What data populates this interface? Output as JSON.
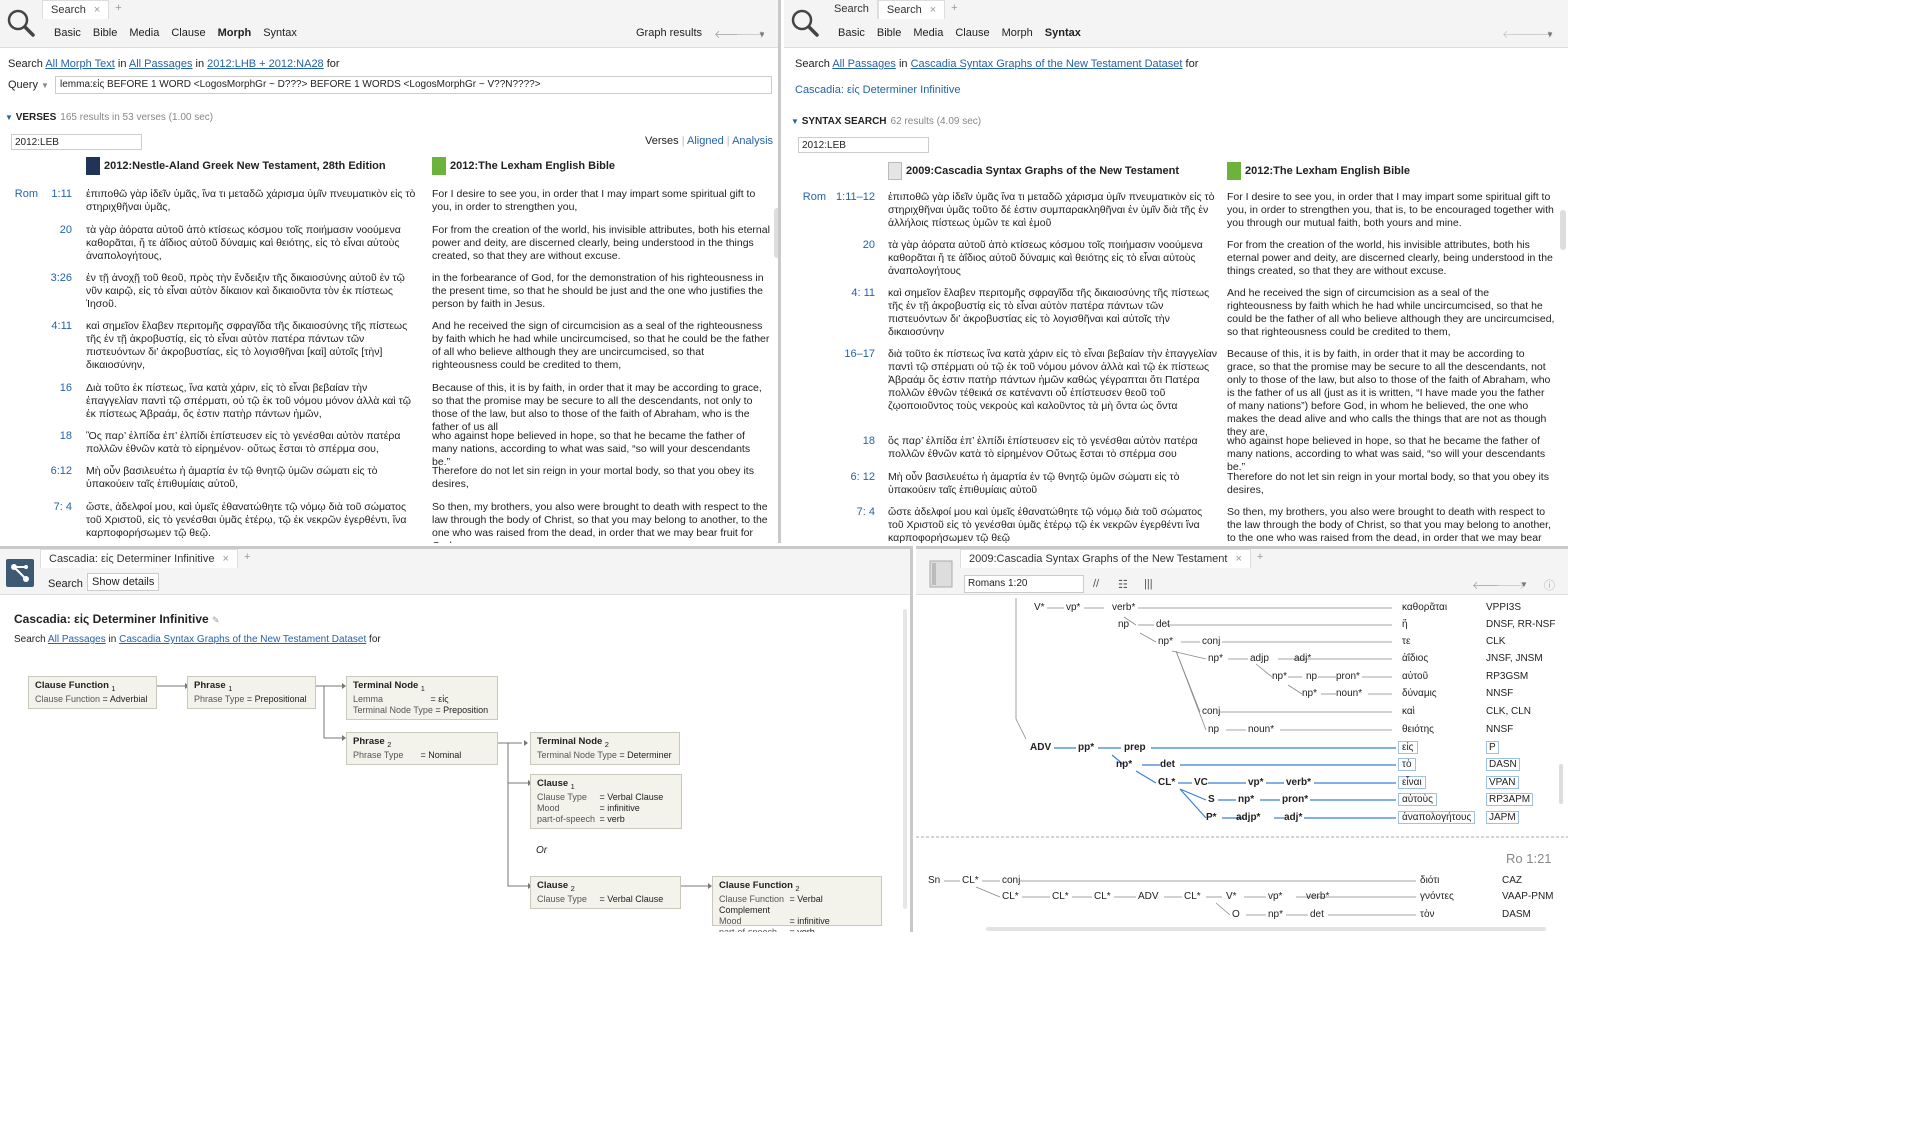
{
  "p1": {
    "tabs": [
      "Search"
    ],
    "subnav": [
      "Basic",
      "Bible",
      "Media",
      "Clause",
      "Morph",
      "Syntax"
    ],
    "graph_results": "Graph results",
    "search_line": {
      "pre": "Search",
      "what": "All Morph Text",
      "in": "in",
      "scope": "All Passages",
      "in2": "in",
      "src": "2012:LHB + 2012:NA28",
      "for": "for"
    },
    "query_label": "Query",
    "query": "lemma:εἰς BEFORE 1 WORD <LogosMorphGr ~ D???> BEFORE 1 WORDS <LogosMorphGr ~ V??N????>",
    "verses_label": "VERSES",
    "verses_count": "165 results in 53 verses (1.00 sec)",
    "version_input": "2012:LEB",
    "view_tabs": [
      "Verses",
      "Aligned",
      "Analysis"
    ],
    "col1": "2012:Nestle-Aland Greek New Testament, 28th Edition",
    "col2": "2012:The Lexham English Bible",
    "rows": [
      {
        "book": "Rom",
        "ref": "1:11",
        "gk": "ἐπιποθῶ γὰρ ἰδεῖν ὑμᾶς, ἵνα τι μεταδῶ χάρισμα ὑμῖν πνευματικὸν εἰς τὸ στηριχθῆναι ὑμᾶς,",
        "en": "For I desire to see you, in order that I may impart some spiritual gift to you, in order to strengthen you,"
      },
      {
        "ref": "20",
        "gk": "τὰ γὰρ ἀόρατα αὐτοῦ ἀπὸ κτίσεως κόσμου τοῖς ποιήμασιν νοούμενα καθορᾶται, ἥ τε ἀΐδιος αὐτοῦ δύναμις καὶ θειότης, εἰς τὸ εἶναι αὐτοὺς ἀναπολογήτους,",
        "en": "For from the creation of the world, his invisible attributes, both his eternal power and deity, are discerned clearly, being understood in the things created, so that they are without excuse."
      },
      {
        "ref": "3:26",
        "gk": "ἐν τῇ ἀνοχῇ τοῦ θεοῦ, πρὸς τὴν ἔνδειξιν τῆς δικαιοσύνης αὐτοῦ ἐν τῷ νῦν καιρῷ, εἰς τὸ εἶναι αὐτὸν δίκαιον καὶ δικαιοῦντα τὸν ἐκ πίστεως Ἰησοῦ.",
        "en": "in the forbearance of God, for the demonstration of his righteousness in the present time, so that he should be just and the one who justifies the person by faith in Jesus."
      },
      {
        "ref": "4:11",
        "gk": "καὶ σημεῖον ἔλαβεν περιτομῆς σφραγῖδα τῆς δικαιοσύνης τῆς πίστεως τῆς ἐν τῇ ἀκροβυστίᾳ, εἰς τὸ εἶναι αὐτὸν πατέρα πάντων τῶν πιστευόντων δι’ ἀκροβυστίας, εἰς τὸ λογισθῆναι [καὶ] αὐτοῖς [τὴν] δικαιοσύνην,",
        "en": "And he received the sign of circumcision as a seal of the righteousness by faith which he had while uncircumcised, so that he could be the father of all who believe although they are uncircumcised, so that righteousness could be credited to them,"
      },
      {
        "ref": "16",
        "gk": "Διὰ τοῦτο ἐκ πίστεως, ἵνα κατὰ χάριν, εἰς τὸ εἶναι βεβαίαν τὴν ἐπαγγελίαν παντὶ τῷ σπέρματι, οὐ τῷ ἐκ τοῦ νόμου μόνον ἀλλὰ καὶ τῷ ἐκ πίστεως Ἀβραάμ, ὅς ἐστιν πατὴρ πάντων ἡμῶν,",
        "en": "Because of this, it is by faith, in order that it may be according to grace, so that the promise may be secure to all the descendants, not only to those of the law, but also to those of the faith of Abraham, who is the father of us all"
      },
      {
        "ref": "18",
        "gk": "Ὃς παρ’ ἐλπίδα ἐπ’ ἐλπίδι ἐπίστευσεν εἰς τὸ γενέσθαι αὐτὸν πατέρα πολλῶν ἐθνῶν κατὰ τὸ εἰρημένον· οὕτως ἔσται τὸ σπέρμα σου,",
        "en": "who against hope believed in hope, so that he became the father of many nations, according to what was said, “so will your descendants be.”"
      },
      {
        "ref": "6:12",
        "gk": "Μὴ οὖν βασιλευέτω ἡ ἁμαρτία ἐν τῷ θνητῷ ὑμῶν σώματι εἰς τὸ ὑπακούειν ταῖς ἐπιθυμίαις αὐτοῦ,",
        "en": "Therefore do not let sin reign in your mortal body, so that you obey its desires,"
      },
      {
        "ref": "7:  4",
        "gk": "ὥστε, ἀδελφοί μου, καὶ ὑμεῖς ἐθανατώθητε τῷ νόμῳ διὰ τοῦ σώματος τοῦ Χριστοῦ, εἰς τὸ γενέσθαι ὑμᾶς ἑτέρῳ, τῷ ἐκ νεκρῶν ἐγερθέντι, ἵνα καρποφορήσωμεν τῷ θεῷ.",
        "en": "So then, my brothers, you also were brought to death with respect to the law through the body of Christ, so that you may belong to another, to the one who was raised from the dead, in order that we may bear fruit for God."
      }
    ]
  },
  "p2": {
    "tabs": [
      "Search",
      "Search"
    ],
    "subnav": [
      "Basic",
      "Bible",
      "Media",
      "Clause",
      "Morph",
      "Syntax"
    ],
    "search_line": {
      "pre": "Search",
      "scope": "All Passages",
      "in": "in",
      "src": "Cascadia Syntax Graphs of the New Testament Dataset",
      "for": "for"
    },
    "query_link": "Cascadia: εἰς Determiner Infinitive",
    "section": "SYNTAX SEARCH",
    "count": "62 results (4.09 sec)",
    "version_input": "2012:LEB",
    "col1": "2009:Cascadia Syntax Graphs of the New Testament",
    "col2": "2012:The Lexham English Bible",
    "rows": [
      {
        "book": "Rom",
        "ref": "1:11–12",
        "gk": "ἐπιποθῶ γὰρ ἰδεῖν ὑμᾶς ἵνα τι μεταδῶ χάρισμα ὑμῖν πνευματικὸν εἰς τὸ στηριχθῆναι ὑμᾶς τοῦτο δέ ἐστιν συμπαρακληθῆναι ἐν ὑμῖν διὰ τῆς ἐν ἀλλήλοις πίστεως ὑμῶν τε καὶ ἐμοῦ",
        "en": "For I desire to see you, in order that I may impart some spiritual gift to you, in order to strengthen you, that is, to be encouraged together with you through our mutual faith, both yours and mine."
      },
      {
        "ref": "20",
        "gk": "τὰ γὰρ ἀόρατα αὐτοῦ ἀπὸ κτίσεως κόσμου τοῖς ποιήμασιν νοούμενα καθορᾶται ἥ τε ἀΐδιος αὐτοῦ δύναμις καὶ θειότης εἰς τὸ εἶναι αὐτοὺς ἀναπολογήτους",
        "en": "For from the creation of the world, his invisible attributes, both his eternal power and deity, are discerned clearly, being understood in the things created, so that they are without excuse."
      },
      {
        "ref": "4:   11",
        "gk": "καὶ σημεῖον ἔλαβεν περιτομῆς σφραγῖδα τῆς δικαιοσύνης τῆς πίστεως τῆς ἐν τῇ ἀκροβυστίᾳ εἰς τὸ εἶναι αὐτὸν πατέρα πάντων τῶν πιστευόντων δι’ ἀκροβυστίας εἰς τὸ λογισθῆναι καὶ αὐτοῖς τὴν δικαιοσύνην",
        "en": "And he received the sign of circumcision as a seal of the righteousness by faith which he had while uncircumcised, so that he could be the father of all who believe although they are uncircumcised, so that righteousness could be credited to them,"
      },
      {
        "ref": "16–17",
        "gk": "διὰ τοῦτο ἐκ πίστεως ἵνα κατὰ χάριν εἰς τὸ εἶναι βεβαίαν τὴν ἐπαγγελίαν παντὶ τῷ σπέρματι οὐ τῷ ἐκ τοῦ νόμου μόνον ἀλλὰ καὶ τῷ ἐκ πίστεως Ἀβραάμ ὅς ἐστιν πατὴρ πάντων ἡμῶν καθὼς γέγραπται ὅτι Πατέρα πολλῶν ἐθνῶν τέθεικά σε κατέναντι οὗ ἐπίστευσεν θεοῦ τοῦ ζῳοποιοῦντος τοὺς νεκροὺς καὶ καλοῦντος τὰ μὴ ὄντα ὡς ὄντα",
        "en": "Because of this, it is by faith, in order that it may be according to grace, so that the promise may be secure to all the descendants, not only to those of the law, but also to those of the faith of Abraham, who is the father of us all (just as it is written, “I have made you the father of many nations”) before God, in whom he believed, the one who makes the dead alive and who calls the things that are not as though they are,"
      },
      {
        "ref": "18",
        "gk": "ὃς παρ’ ἐλπίδα ἐπ’ ἐλπίδι ἐπίστευσεν εἰς τὸ γενέσθαι αὐτὸν πατέρα πολλῶν ἐθνῶν κατὰ τὸ εἰρημένον Οὕτως ἔσται τὸ σπέρμα σου",
        "en": "who against hope believed in hope, so that he became the father of many nations, according to what was said, “so will your descendants be.”"
      },
      {
        "ref": "6:   12",
        "gk": "Μὴ οὖν βασιλευέτω ἡ ἁμαρτία ἐν τῷ θνητῷ ὑμῶν σώματι εἰς τὸ ὑπακούειν ταῖς ἐπιθυμίαις αὐτοῦ",
        "en": "Therefore do not let sin reign in your mortal body, so that you obey its desires,"
      },
      {
        "ref": "7:     4",
        "gk": "ὥστε ἀδελφοί μου καὶ ὑμεῖς ἐθανατώθητε τῷ νόμῳ διὰ τοῦ σώματος τοῦ Χριστοῦ εἰς τὸ γενέσθαι ὑμᾶς ἑτέρῳ τῷ ἐκ νεκρῶν ἐγερθέντι ἵνα καρποφορήσωμεν τῷ θεῷ",
        "en": "So then, my brothers, you also were brought to death with respect to the law through the body of Christ, so that you may belong to another, to the one who was raised from the dead, in order that we may bear fruit for"
      }
    ]
  },
  "p3": {
    "tab": "Cascadia: εἰς Determiner Infinitive",
    "search_btn": "Search",
    "details_btn": "Show details",
    "title": "Cascadia: εἰς Determiner Infinitive",
    "search_line": {
      "pre": "Search",
      "scope": "All Passages",
      "in": "in",
      "src": "Cascadia Syntax Graphs of the New Testament Dataset",
      "for": "for"
    },
    "nodes": {
      "cf1": {
        "title": "Clause Function",
        "sub": "1",
        "k": "Clause Function",
        "v": "Adverbial"
      },
      "ph1": {
        "title": "Phrase",
        "sub": "1",
        "k": "Phrase Type",
        "v": "Prepositional"
      },
      "tn1": {
        "title": "Terminal Node",
        "sub": "1",
        "k1": "Lemma",
        "v1": "εἰς",
        "k2": "Terminal Node Type",
        "v2": "Preposition"
      },
      "ph2": {
        "title": "Phrase",
        "sub": "2",
        "k": "Phrase Type",
        "v": "Nominal"
      },
      "tn2": {
        "title": "Terminal Node",
        "sub": "2",
        "k": "Terminal Node Type",
        "v": "Determiner"
      },
      "cl1": {
        "title": "Clause",
        "sub": "1",
        "k1": "Clause Type",
        "v1": "Verbal Clause",
        "k2": "Mood",
        "v2": "infinitive",
        "k3": "part-of-speech",
        "v3": "verb"
      },
      "or": "Or",
      "cl2": {
        "title": "Clause",
        "sub": "2",
        "k": "Clause Type",
        "v": "Verbal Clause"
      },
      "cf2": {
        "title": "Clause Function",
        "sub": "2",
        "k1": "Clause Function",
        "v1": "Verbal Complement",
        "k2": "Mood",
        "v2": "infinitive",
        "k3": "part-of-speech",
        "v3": "verb"
      }
    }
  },
  "p4": {
    "tab": "2009:Cascadia Syntax Graphs of the New Testament",
    "ref_input": "Romans 1:20",
    "ref_label": "Ro 1:21",
    "tree_labels": [
      "V*",
      "vp*",
      "verb*",
      "np",
      "det",
      "np*",
      "conj",
      "np*",
      "adjp",
      "adj*",
      "np*",
      "np",
      "pron*",
      "np*",
      "noun*",
      "conj",
      "np",
      "noun*",
      "ADV",
      "pp*",
      "prep",
      "np*",
      "det",
      "CL*",
      "VC",
      "vp*",
      "verb*",
      "S",
      "np*",
      "pron*",
      "P*",
      "adjp*",
      "adj*",
      "Sn",
      "CL*",
      "conj",
      "CL*",
      "CL*",
      "CL*",
      "ADV",
      "CL*",
      "V*",
      "vp*",
      "verb*",
      "O",
      "np*",
      "det"
    ],
    "words": [
      "καθορᾶται",
      "ἥ",
      "τε",
      "ἀΐδιος",
      "αὐτοῦ",
      "δύναμις",
      "καὶ",
      "θειότης",
      "εἰς",
      "τὸ",
      "εἶναι",
      "αὐτοὺς",
      "ἀναπολογήτους",
      "διότι",
      "γνόντες",
      "τὸν"
    ],
    "morph": [
      "VPPI3S",
      "DNSF, RR-NSF",
      "CLK",
      "JNSF, JNSM",
      "RP3GSM",
      "NNSF",
      "CLK, CLN",
      "NNSF",
      "P",
      "DASN",
      "VPAN",
      "RP3APM",
      "JAPM",
      "CAZ",
      "VAAP-PNM",
      "DASM"
    ]
  }
}
